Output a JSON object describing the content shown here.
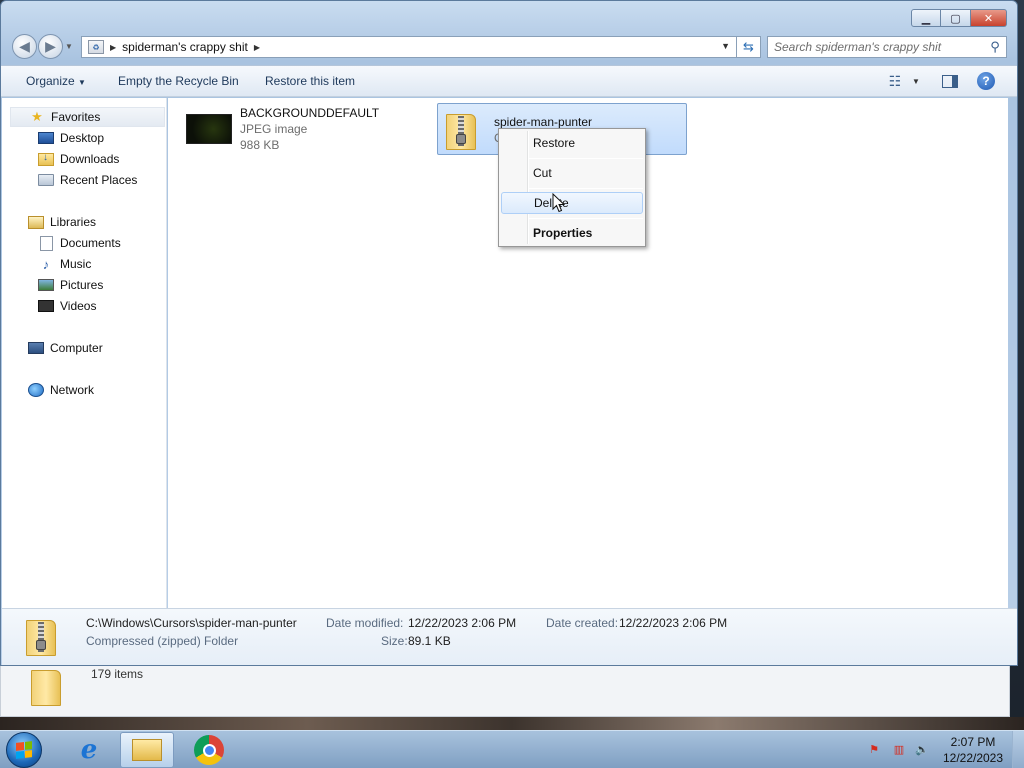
{
  "window": {
    "address": "spiderman's crappy shit",
    "search_placeholder": "Search spiderman's crappy shit"
  },
  "toolbar": {
    "organize": "Organize",
    "empty_bin": "Empty the Recycle Bin",
    "restore_item": "Restore this item"
  },
  "nav": {
    "favorites": "Favorites",
    "desktop": "Desktop",
    "downloads": "Downloads",
    "recent": "Recent Places",
    "libraries": "Libraries",
    "documents": "Documents",
    "music": "Music",
    "pictures": "Pictures",
    "videos": "Videos",
    "computer": "Computer",
    "network": "Network"
  },
  "files": [
    {
      "name": "BACKGROUNDDEFAULT",
      "type": "JPEG image",
      "size": "988 KB"
    },
    {
      "name": "spider-man-punter",
      "type": "C"
    }
  ],
  "context_menu": {
    "restore": "Restore",
    "cut": "Cut",
    "delete": "Delete",
    "properties": "Properties"
  },
  "details": {
    "path": "C:\\Windows\\Cursors\\spider-man-punter",
    "kind": "Compressed (zipped) Folder",
    "modified_label": "Date modified:",
    "modified": "12/22/2023 2:06 PM",
    "size_label": "Size:",
    "size": "89.1 KB",
    "created_label": "Date created:",
    "created": "12/22/2023 2:06 PM"
  },
  "background_window": {
    "count": "179 items"
  },
  "taskbar": {
    "time": "2:07 PM",
    "date": "12/22/2023"
  },
  "icons": {
    "back": "back-arrow-icon",
    "forward": "forward-arrow-icon",
    "refresh": "refresh-icon",
    "search": "search-icon",
    "help": "help-icon",
    "zip": "zip-folder-icon"
  }
}
